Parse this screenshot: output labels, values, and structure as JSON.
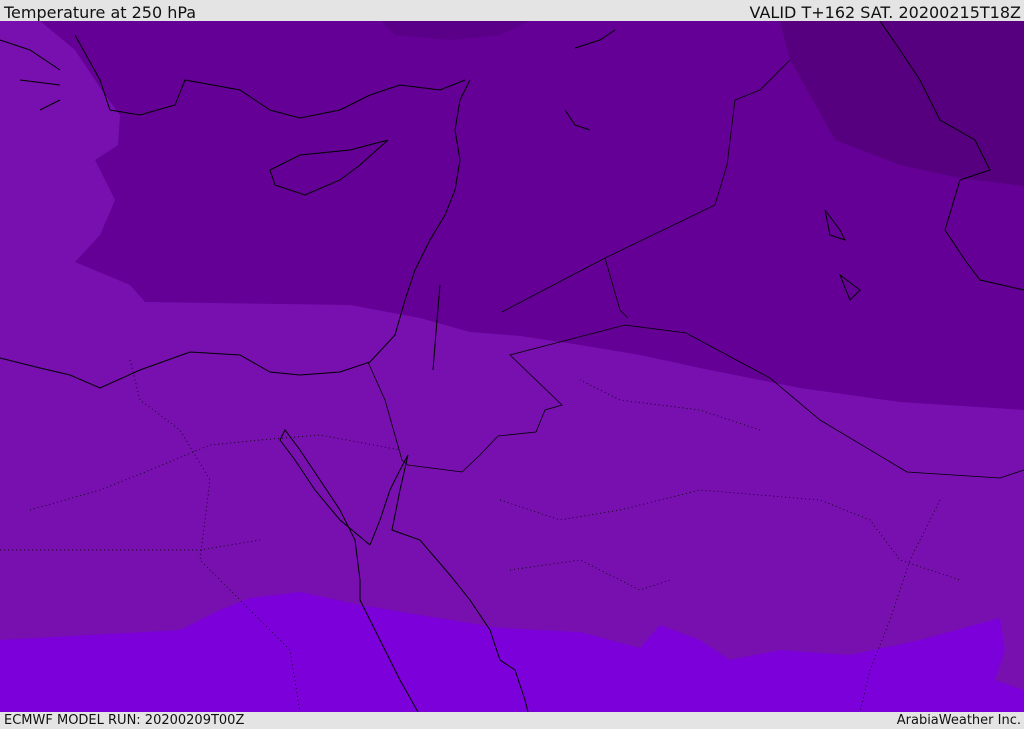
{
  "header": {
    "title": "Temperature at 250 hPa",
    "valid": "VALID T+162 SAT. 20200215T18Z"
  },
  "footer": {
    "model_run": "ECMWF MODEL RUN: 20200209T00Z",
    "credit": "ArabiaWeather Inc."
  },
  "colors": {
    "darkest": "#560080",
    "dark": "#650096",
    "mid": "#7810b0",
    "bright": "#7c00da",
    "coast": "#000000"
  }
}
